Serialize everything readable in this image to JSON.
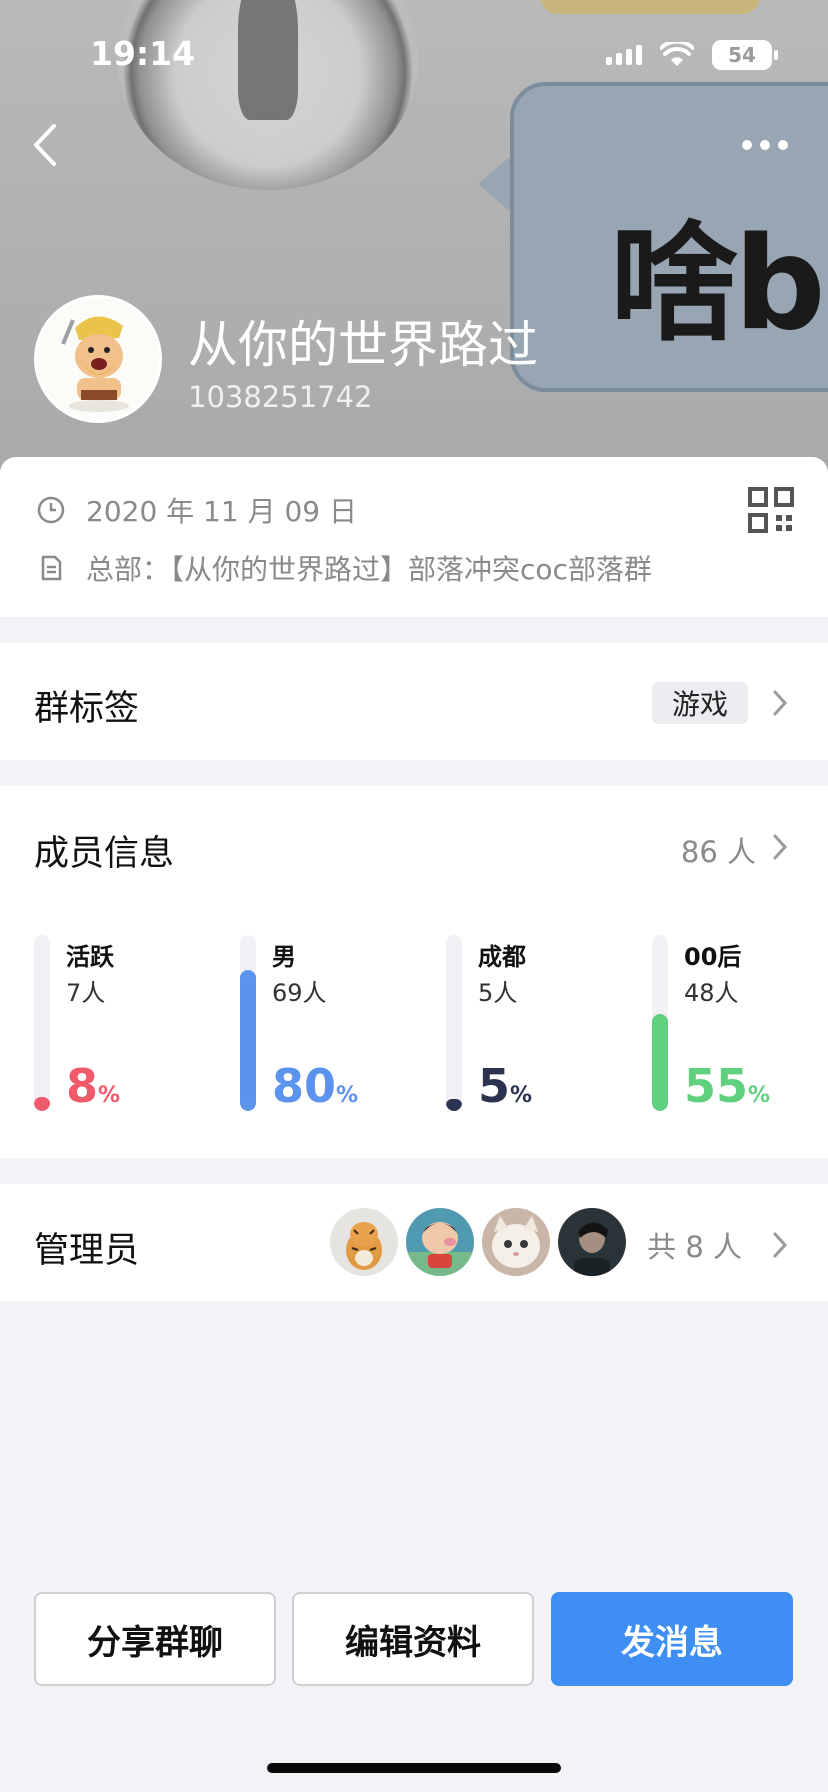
{
  "status_bar": {
    "time": "19:14",
    "battery": "54"
  },
  "header": {
    "bubble_text": "啥b",
    "group_name": "从你的世界路过",
    "group_id": "1038251742"
  },
  "info": {
    "date": "2020 年 11 月 09 日",
    "headquarters": "总部：【从你的世界路过】部落冲突coc部落群"
  },
  "tags": {
    "label": "群标签",
    "value": "游戏"
  },
  "members": {
    "label": "成员信息",
    "count": "86 人",
    "stats": [
      {
        "title": "活跃",
        "sub": "7人",
        "pct": "8",
        "unit": "%",
        "fraction": 0.08,
        "color": "#f05a6a"
      },
      {
        "title": "男",
        "sub": "69人",
        "pct": "80",
        "unit": "%",
        "fraction": 0.8,
        "color": "#5b93ee"
      },
      {
        "title": "成都",
        "sub": "5人",
        "pct": "5",
        "unit": "%",
        "fraction": 0.05,
        "color": "#2c3350"
      },
      {
        "title": "00后",
        "sub": "48人",
        "pct": "55",
        "unit": "%",
        "fraction": 0.55,
        "color": "#5fd07e"
      }
    ]
  },
  "admins": {
    "label": "管理员",
    "count": "共 8 人"
  },
  "buttons": {
    "share": "分享群聊",
    "edit": "编辑资料",
    "send": "发消息"
  }
}
